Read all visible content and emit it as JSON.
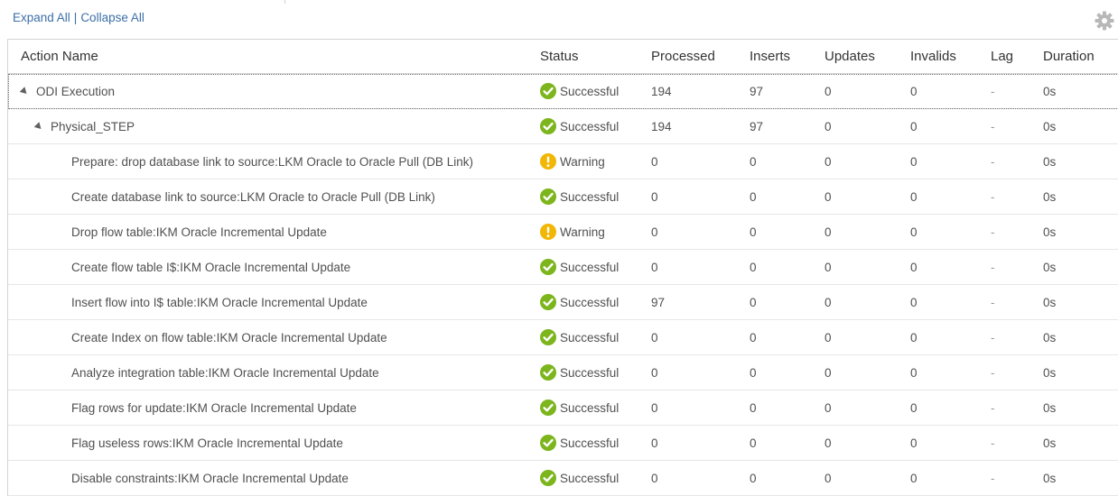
{
  "toolbar": {
    "expand_all": "Expand All",
    "separator": "|",
    "collapse_all": "Collapse All",
    "settings_icon": "gear-icon"
  },
  "columns": {
    "name": "Action Name",
    "status": "Status",
    "processed": "Processed",
    "inserts": "Inserts",
    "updates": "Updates",
    "invalids": "Invalids",
    "lag": "Lag",
    "duration": "Duration"
  },
  "colors": {
    "success": "#7cb51c",
    "warning": "#f2b705",
    "link": "#3d6fa8"
  },
  "rows": [
    {
      "name": "ODI Execution",
      "level": 0,
      "expanded": true,
      "status": "Successful",
      "status_type": "success",
      "processed": "194",
      "inserts": "97",
      "updates": "0",
      "invalids": "0",
      "lag": "-",
      "duration": "0s"
    },
    {
      "name": "Physical_STEP",
      "level": 1,
      "expanded": true,
      "status": "Successful",
      "status_type": "success",
      "processed": "194",
      "inserts": "97",
      "updates": "0",
      "invalids": "0",
      "lag": "-",
      "duration": "0s"
    },
    {
      "name": "Prepare: drop database link to source:LKM Oracle to Oracle Pull (DB Link)",
      "level": 2,
      "status": "Warning",
      "status_type": "warning",
      "processed": "0",
      "inserts": "0",
      "updates": "0",
      "invalids": "0",
      "lag": "-",
      "duration": "0s"
    },
    {
      "name": "Create database link to source:LKM Oracle to Oracle Pull (DB Link)",
      "level": 2,
      "status": "Successful",
      "status_type": "success",
      "processed": "0",
      "inserts": "0",
      "updates": "0",
      "invalids": "0",
      "lag": "-",
      "duration": "0s"
    },
    {
      "name": "Drop flow table:IKM Oracle Incremental Update",
      "level": 2,
      "status": "Warning",
      "status_type": "warning",
      "processed": "0",
      "inserts": "0",
      "updates": "0",
      "invalids": "0",
      "lag": "-",
      "duration": "0s"
    },
    {
      "name": "Create flow table I$:IKM Oracle Incremental Update",
      "level": 2,
      "status": "Successful",
      "status_type": "success",
      "processed": "0",
      "inserts": "0",
      "updates": "0",
      "invalids": "0",
      "lag": "-",
      "duration": "0s"
    },
    {
      "name": "Insert flow into I$ table:IKM Oracle Incremental Update",
      "level": 2,
      "status": "Successful",
      "status_type": "success",
      "processed": "97",
      "inserts": "0",
      "updates": "0",
      "invalids": "0",
      "lag": "-",
      "duration": "0s"
    },
    {
      "name": "Create Index on flow table:IKM Oracle Incremental Update",
      "level": 2,
      "status": "Successful",
      "status_type": "success",
      "processed": "0",
      "inserts": "0",
      "updates": "0",
      "invalids": "0",
      "lag": "-",
      "duration": "0s"
    },
    {
      "name": "Analyze integration table:IKM Oracle Incremental Update",
      "level": 2,
      "status": "Successful",
      "status_type": "success",
      "processed": "0",
      "inserts": "0",
      "updates": "0",
      "invalids": "0",
      "lag": "-",
      "duration": "0s"
    },
    {
      "name": "Flag rows for update:IKM Oracle Incremental Update",
      "level": 2,
      "status": "Successful",
      "status_type": "success",
      "processed": "0",
      "inserts": "0",
      "updates": "0",
      "invalids": "0",
      "lag": "-",
      "duration": "0s"
    },
    {
      "name": "Flag useless rows:IKM Oracle Incremental Update",
      "level": 2,
      "status": "Successful",
      "status_type": "success",
      "processed": "0",
      "inserts": "0",
      "updates": "0",
      "invalids": "0",
      "lag": "-",
      "duration": "0s"
    },
    {
      "name": "Disable constraints:IKM Oracle Incremental Update",
      "level": 2,
      "status": "Successful",
      "status_type": "success",
      "processed": "0",
      "inserts": "0",
      "updates": "0",
      "invalids": "0",
      "lag": "-",
      "duration": "0s"
    }
  ]
}
